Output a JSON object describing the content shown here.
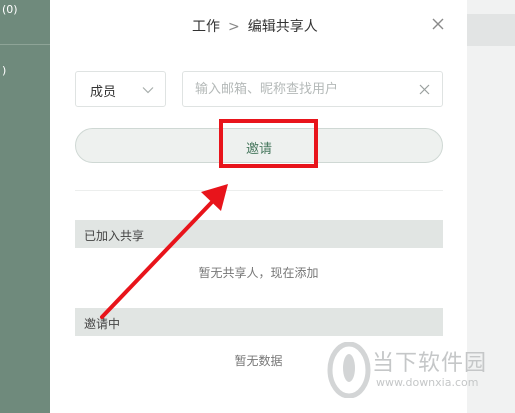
{
  "sidebar": {
    "items": [
      {
        "count_text": "(0)"
      },
      {
        "count_text": ")"
      }
    ]
  },
  "dialog": {
    "breadcrumb": {
      "parent": "工作",
      "separator": ">",
      "current": "编辑共享人"
    },
    "role_select": {
      "selected": "成员"
    },
    "search": {
      "placeholder": "输入邮箱、昵称查找用户",
      "value": ""
    },
    "invite_button": {
      "label": "邀请"
    },
    "joined_section": {
      "title": "已加入共享",
      "empty_text": "暂无共享人，现在添加"
    },
    "pending_section": {
      "title": "邀请中",
      "empty_text": "暂无数据"
    }
  },
  "annotation": {
    "color": "#e8141b"
  },
  "watermark": {
    "title": "当下软件园",
    "url": "www.downxia.com"
  },
  "colors": {
    "sidebar": "#6f8a7c",
    "accent": "#4a7a60",
    "section_bg": "#e1e5e3"
  }
}
